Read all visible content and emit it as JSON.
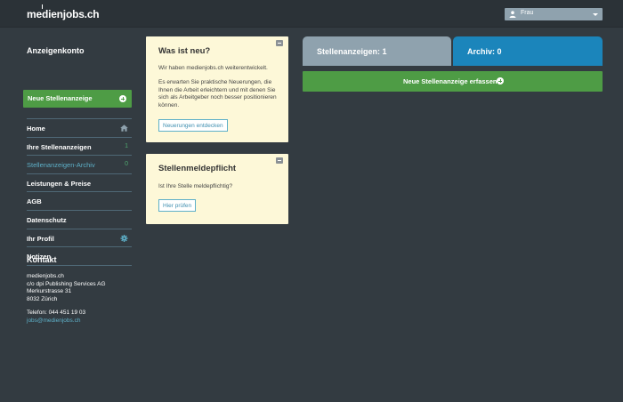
{
  "header": {
    "logo": "medienjobs.ch",
    "user_select": {
      "value": "Frau",
      "icon": "user-icon"
    }
  },
  "sidebar": {
    "title": "Anzeigenkonto",
    "new_button": {
      "label": "Neue Stellenanzeige",
      "icon": "plus-circle-icon"
    },
    "items": [
      {
        "label": "Home",
        "icon": "home-icon"
      },
      {
        "label": "Ihre Stellenanzeigen",
        "count": "1"
      },
      {
        "label": "Stellenanzeigen-Archiv",
        "count": "0",
        "active": true
      },
      {
        "label": "Leistungen & Preise"
      },
      {
        "label": "AGB"
      },
      {
        "label": "Datenschutz"
      },
      {
        "label": "Ihr Profil",
        "icon": "gear-icon"
      },
      {
        "label": "Notizen"
      }
    ]
  },
  "contact": {
    "title": "Kontakt",
    "company": "medienjobs.ch",
    "company2": "c/o dpi Publishing Services AG",
    "street": "Merkurstrasse 31",
    "city": "8032 Zürich",
    "phone": "Telefon: 044 451 19 03",
    "email": "jobs@medienjobs.ch"
  },
  "cards": {
    "news": {
      "title": "Was ist neu?",
      "text1": "Wir haben medienjobs.ch weiterentwickelt.",
      "text2": "Es erwarten Sie praktische Neuerungen, die Ihnen die Arbeit erleichtern und mit denen Sie sich als Arbeitgeber noch besser positionieren können.",
      "button": "Neuerungen entdecken"
    },
    "meldepflicht": {
      "title": "Stellenmeldepflicht",
      "text": "Ist Ihre Stelle meldepflichtig?",
      "button": "Hier prüfen"
    }
  },
  "main": {
    "tab_active": "Stellenanzeigen: 1",
    "tab_archive": "Archiv: 0",
    "new_button": "Neue Stellenanzeige erfassen"
  },
  "colors": {
    "background": "#333b41",
    "topbar": "#2b3237",
    "green": "#4e9c45",
    "tab_grey": "#8fa2ae",
    "tab_blue": "#1b85bb",
    "card": "#fdf8d8",
    "link": "#5eb0c8"
  }
}
